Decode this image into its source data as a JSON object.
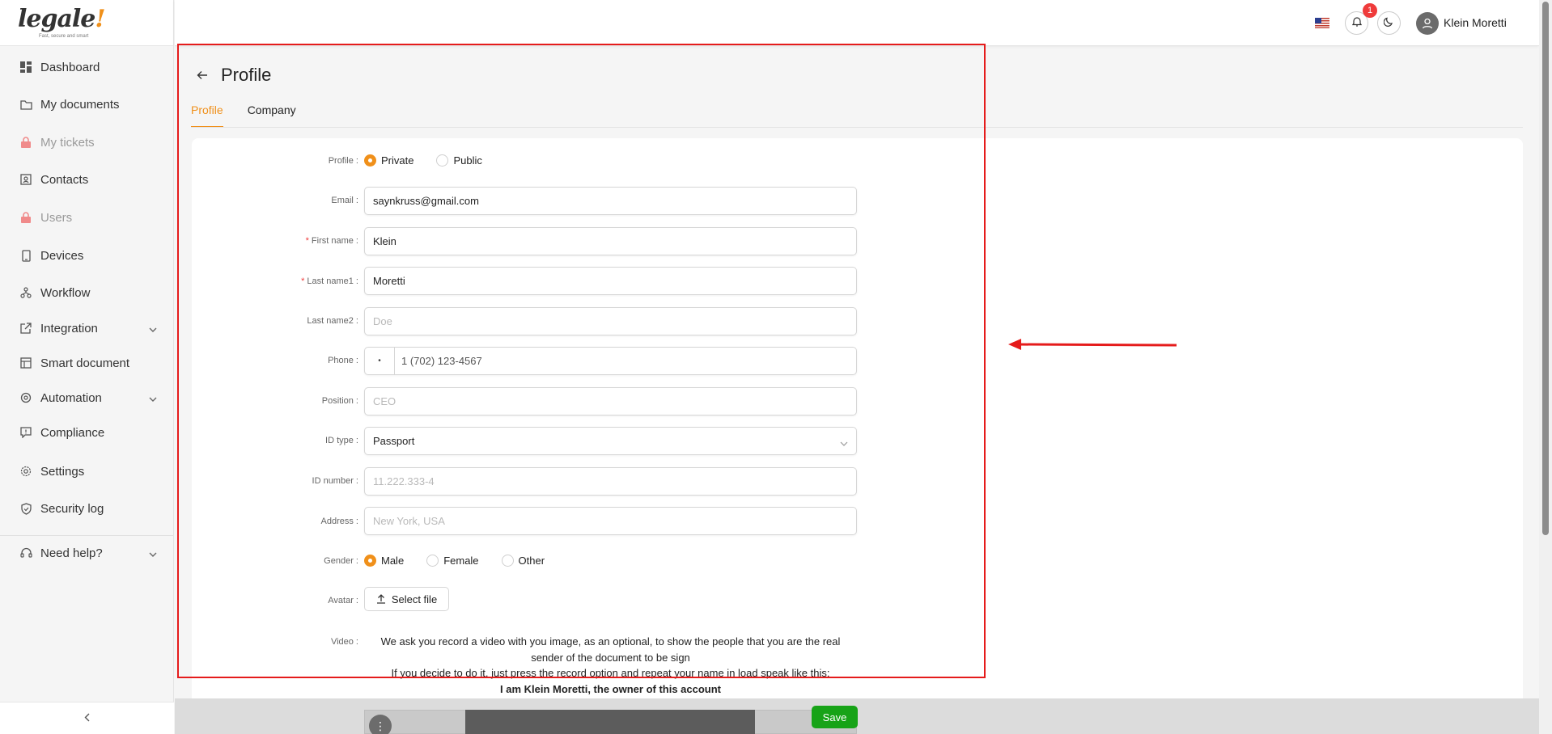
{
  "brand": {
    "logo_text": "legale",
    "logo_mark": "!",
    "tagline": "Fast, secure and smart"
  },
  "sidebar": {
    "items": [
      {
        "label": "Dashboard",
        "icon": "dashboard-icon",
        "locked": false
      },
      {
        "label": "My documents",
        "icon": "folder-icon",
        "locked": false
      },
      {
        "label": "My tickets",
        "icon": "lock-icon",
        "locked": true
      },
      {
        "label": "Contacts",
        "icon": "contacts-icon",
        "locked": false
      },
      {
        "label": "Users",
        "icon": "lock-icon",
        "locked": true
      },
      {
        "label": "Devices",
        "icon": "device-icon",
        "locked": false
      },
      {
        "label": "Workflow",
        "icon": "workflow-icon",
        "locked": false
      },
      {
        "label": "Integration",
        "icon": "external-link-icon",
        "locked": false,
        "expandable": true
      },
      {
        "label": "Smart document",
        "icon": "smart-document-icon",
        "locked": false
      },
      {
        "label": "Automation",
        "icon": "automation-icon",
        "locked": false,
        "expandable": true
      },
      {
        "label": "Compliance",
        "icon": "compliance-icon",
        "locked": false
      },
      {
        "label": "Settings",
        "icon": "gear-icon",
        "locked": false
      },
      {
        "label": "Security log",
        "icon": "shield-icon",
        "locked": false
      }
    ],
    "help": {
      "label": "Need help?",
      "icon": "headset-icon"
    },
    "collapse_icon": "chevron-left-icon"
  },
  "header": {
    "language_icon": "us-flag-icon",
    "notifications_count": "1",
    "user_name": "Klein Moretti"
  },
  "page": {
    "title": "Profile",
    "tabs": [
      {
        "label": "Profile",
        "active": true
      },
      {
        "label": "Company",
        "active": false
      }
    ]
  },
  "form": {
    "profile": {
      "label": "Profile",
      "options": [
        "Private",
        "Public"
      ],
      "selected": "Private"
    },
    "email": {
      "label": "Email",
      "value": "saynkruss@gmail.com"
    },
    "first_name": {
      "label": "First name",
      "value": "Klein",
      "required": true
    },
    "last_name1": {
      "label": "Last name1",
      "value": "Moretti",
      "required": true
    },
    "last_name2": {
      "label": "Last name2",
      "placeholder": "Doe"
    },
    "phone": {
      "label": "Phone",
      "prefix": "•",
      "value": "1 (702) 123-4567"
    },
    "position": {
      "label": "Position",
      "placeholder": "CEO"
    },
    "id_type": {
      "label": "ID type",
      "value": "Passport"
    },
    "id_number": {
      "label": "ID number",
      "placeholder": "11.222.333-4"
    },
    "address": {
      "label": "Address",
      "placeholder": "New York, USA"
    },
    "gender": {
      "label": "Gender",
      "options": [
        "Male",
        "Female",
        "Other"
      ],
      "selected": "Male"
    },
    "avatar": {
      "label": "Avatar",
      "button": "Select file"
    },
    "video": {
      "label": "Video",
      "line1": "We ask you record a video with you image, as an optional, to show the people that you are the real",
      "line2": "sender of the document to be sign",
      "line3": "If you decide to do it, just press the record option and repeat your name in load speak like this:",
      "line4": "I am Klein Moretti, the owner of this account"
    },
    "save_label": "Save"
  },
  "colors": {
    "accent": "#f0901a",
    "annotation": "#e51b1b",
    "save": "#17a317",
    "badge": "#ef3b3b"
  }
}
